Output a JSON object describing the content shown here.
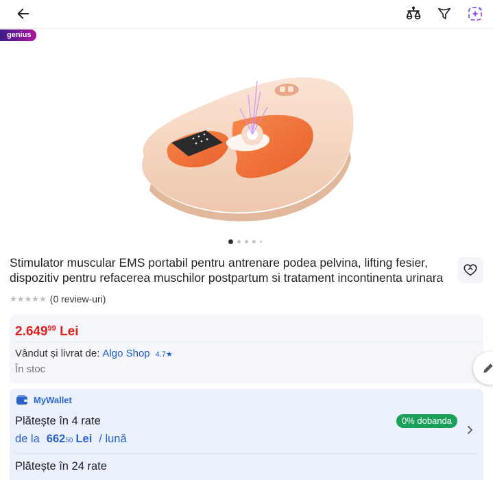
{
  "header": {
    "back_icon": "arrow-left-icon",
    "compare_icon": "compare-scale-icon",
    "filter_icon": "filter-icon",
    "ai_icon": "ai-sparkle-icon"
  },
  "badge": {
    "genius": "genius"
  },
  "product": {
    "title": "Stimulator muscular EMS portabil pentru antrenare podea pelvina, lifting fesier, dispozitiv pentru refacerea muschilor postpartum si tratament incontinenta urinara",
    "reviews": "(0 review-uri)",
    "stars_filled": 0,
    "stars_total": 5,
    "image_page": 1,
    "image_count": 5
  },
  "price": {
    "whole": "2.649",
    "decimals": "99",
    "currency": "Lei"
  },
  "seller": {
    "label": "Vândut și livrat de:",
    "name": "Algo Shop",
    "rating": "4.7★",
    "stock": "În stoc"
  },
  "wallet": {
    "title": "MyWallet",
    "plan1": {
      "title": "Plătește în 4 rate",
      "prefix": "de la",
      "amount_whole": "662",
      "amount_decimals": "50",
      "currency": "Lei",
      "period": "/ lună",
      "badge": "0% dobanda"
    },
    "plan2": {
      "title": "Plătește în 24 rate"
    }
  },
  "colors": {
    "price": "#e1201d",
    "link": "#1e5cc7",
    "wallet_bg": "#eaf1fd",
    "interest_badge": "#1ba05a",
    "genius_gradient": [
      "#3a1c8c",
      "#b0159e"
    ]
  }
}
